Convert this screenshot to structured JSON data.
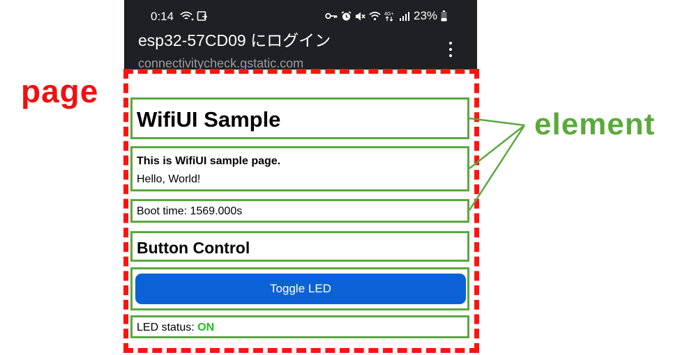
{
  "status_bar": {
    "time": "0:14",
    "battery": "23%",
    "icons_left": [
      "wifi-question-icon",
      "screenshot-icon"
    ],
    "icons_right": [
      "key-icon",
      "alarm-icon",
      "mute-icon",
      "wifi-icon",
      "mobile-data-4g-icon",
      "signal-icon",
      "battery-icon"
    ]
  },
  "browser": {
    "title": "esp32-57CD09 にログイン",
    "url": "connectivitycheck.gstatic.com",
    "menu_icon": "more-vert-icon"
  },
  "annotations": {
    "page_label": "page",
    "element_label": "element",
    "page_color": "#ee1111",
    "element_color": "#5aaa3a"
  },
  "content": {
    "heading": "WifiUI Sample",
    "description_bold": "This is WifiUI sample page.",
    "description_text": "Hello, World!",
    "boot_time": "Boot time: 1569.000s",
    "button_section_heading": "Button Control",
    "toggle_button_label": "Toggle LED",
    "led_status_label": "LED status: ",
    "led_status_value": "ON"
  },
  "colors": {
    "header_bg": "#1f2023",
    "button_bg": "#0b62d6",
    "led_on": "#20c020"
  }
}
